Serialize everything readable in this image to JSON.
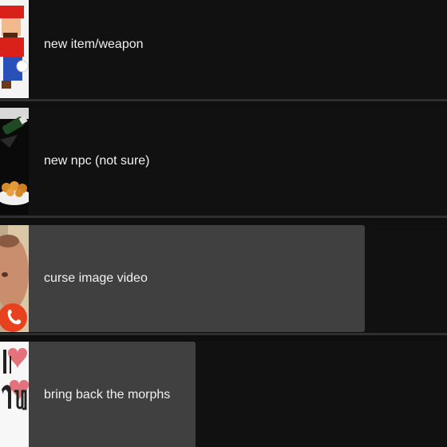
{
  "items": [
    {
      "label": "new item/weapon",
      "fill": 1.0,
      "thumbnail": "mario-thumbnail"
    },
    {
      "label": "new npc (not sure)",
      "fill": 1.0,
      "thumbnail": "wine-and-food-thumbnail"
    },
    {
      "label": "curse image video",
      "fill": 0.77,
      "thumbnail": "man-face-call-thumbnail"
    },
    {
      "label": "bring back the morphs",
      "fill": 0.36,
      "thumbnail": "text-heart-thumbnail"
    }
  ],
  "colors": {
    "background": "#0f0f0f",
    "row": "#111111",
    "filled_bar": "#404040",
    "divider": "#2f2f2f",
    "text": "#f1f1f1",
    "call_button": "#e8411e"
  }
}
